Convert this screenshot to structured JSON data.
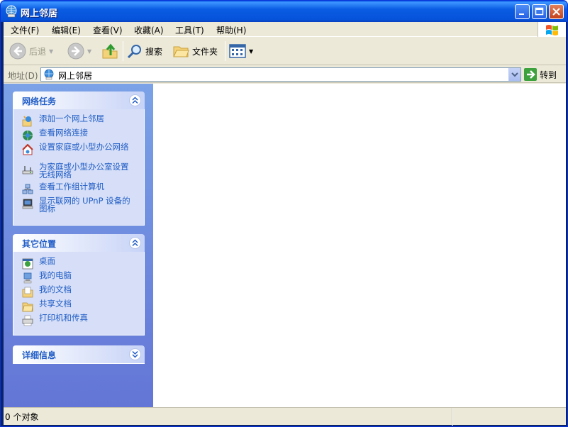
{
  "window": {
    "title": "网上邻居"
  },
  "menu": [
    {
      "label": "文件(F)"
    },
    {
      "label": "编辑(E)"
    },
    {
      "label": "查看(V)"
    },
    {
      "label": "收藏(A)"
    },
    {
      "label": "工具(T)"
    },
    {
      "label": "帮助(H)"
    }
  ],
  "toolbar": {
    "back": "后退",
    "search": "搜索",
    "folders": "文件夹"
  },
  "address": {
    "label": "地址(D)",
    "value": "网上邻居",
    "go": "转到"
  },
  "tasks": {
    "title": "网络任务",
    "items": [
      {
        "label": "添加一个网上邻居",
        "icon": "add-network-place-icon"
      },
      {
        "label": "查看网络连接",
        "icon": "network-connections-icon"
      },
      {
        "label": "设置家庭或小型办公网络",
        "icon": "home-network-icon"
      },
      {
        "label": "为家庭或小型办公室设置无线网络",
        "icon": "wireless-network-icon"
      },
      {
        "label": "查看工作组计算机",
        "icon": "workgroup-icon"
      },
      {
        "label": "显示联网的 UPnP 设备的图标",
        "icon": "upnp-device-icon"
      }
    ]
  },
  "places": {
    "title": "其它位置",
    "items": [
      {
        "label": "桌面",
        "icon": "desktop-icon"
      },
      {
        "label": "我的电脑",
        "icon": "my-computer-icon"
      },
      {
        "label": "我的文档",
        "icon": "my-documents-icon"
      },
      {
        "label": "共享文档",
        "icon": "shared-documents-icon"
      },
      {
        "label": "打印机和传真",
        "icon": "printers-faxes-icon"
      }
    ]
  },
  "details": {
    "title": "详细信息"
  },
  "status": {
    "text": "0 个对象"
  },
  "colors": {
    "link": "#215DC6",
    "titlebar": "#0A5CE2",
    "pane": "#7BA2E7"
  }
}
